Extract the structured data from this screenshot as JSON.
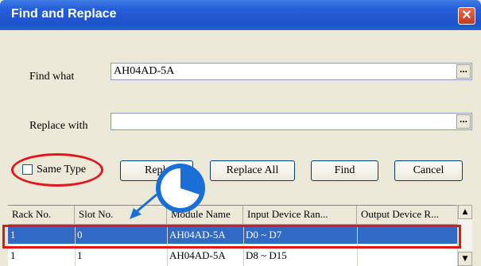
{
  "dialog": {
    "title": "Find and Replace",
    "close_glyph": "✕"
  },
  "find": {
    "label": "Find what",
    "value": "AH04AD-5A",
    "browse_label": "..."
  },
  "replace": {
    "label": "Replace with",
    "value": "",
    "browse_label": "..."
  },
  "options": {
    "same_type_label": "Same Type",
    "same_type_checked": false
  },
  "buttons": {
    "replace": "Replace",
    "replace_visible": "Repl",
    "replace_all": "Replace All",
    "find": "Find",
    "cancel": "Cancel"
  },
  "table": {
    "columns": [
      "Rack No.",
      "Slot No.",
      "Module Name",
      "Input Device Ran...",
      "Output Device R..."
    ],
    "rows": [
      [
        "1",
        "0",
        "AH04AD-5A",
        "D0 ~ D7",
        ""
      ],
      [
        "1",
        "1",
        "AH04AD-5A",
        "D8 ~ D15",
        ""
      ]
    ],
    "selected_row": 0
  },
  "scrollbar": {
    "up_glyph": "▲",
    "down_glyph": "▼"
  },
  "colors": {
    "titlebar": "#245edb",
    "selection": "#316ac5",
    "callout_red": "#e0181e",
    "callout_blue": "#1a6fd6"
  },
  "icons": [
    "close-icon",
    "pie-cursor-icon",
    "arrow-icon"
  ]
}
